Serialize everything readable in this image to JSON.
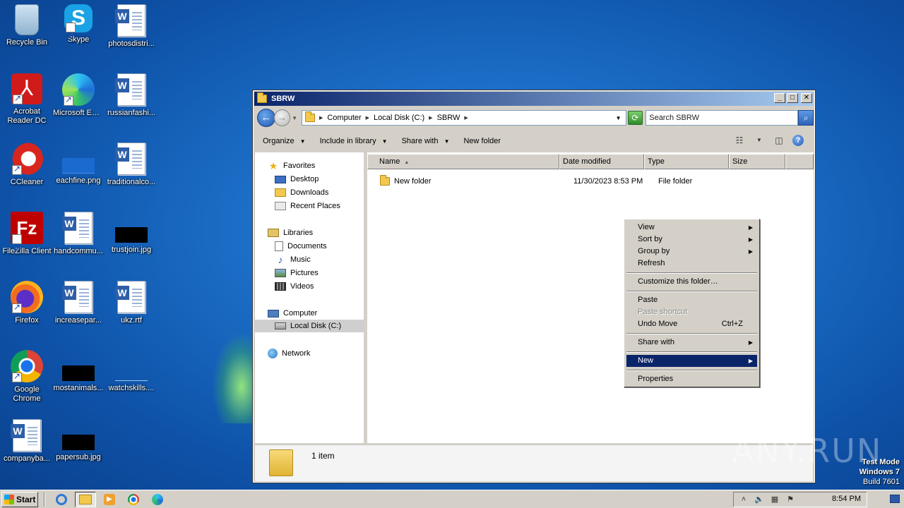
{
  "desktop": {
    "icons": [
      {
        "label": "Recycle Bin",
        "icon": "recycle-bin-icon"
      },
      {
        "label": "Skype",
        "icon": "skype-icon",
        "glyph": "S"
      },
      {
        "label": "photosdistri...",
        "icon": "word-document-icon"
      },
      {
        "label": "Acrobat Reader DC",
        "icon": "acrobat-icon"
      },
      {
        "label": "Microsoft Edge",
        "icon": "edge-icon"
      },
      {
        "label": "russianfashi...",
        "icon": "word-document-icon"
      },
      {
        "label": "CCleaner",
        "icon": "ccleaner-icon"
      },
      {
        "label": "eachfine.png",
        "icon": "image-file-icon"
      },
      {
        "label": "traditionalco...",
        "icon": "word-document-icon"
      },
      {
        "label": "FileZilla Client",
        "icon": "filezilla-icon",
        "glyph": "Fz"
      },
      {
        "label": "handcommu...",
        "icon": "word-document-icon"
      },
      {
        "label": "trustjoin.jpg",
        "icon": "image-file-icon"
      },
      {
        "label": "Firefox",
        "icon": "firefox-icon"
      },
      {
        "label": "increasepar...",
        "icon": "word-document-icon"
      },
      {
        "label": "ukz.rtf",
        "icon": "word-document-icon"
      },
      {
        "label": "Google Chrome",
        "icon": "chrome-icon"
      },
      {
        "label": "mostanimals...",
        "icon": "image-file-icon"
      },
      {
        "label": "watchskills....",
        "icon": "image-file-icon"
      },
      {
        "label": "companyba...",
        "icon": "word-document-icon"
      },
      {
        "label": "papersub.jpg",
        "icon": "image-file-icon"
      }
    ]
  },
  "window": {
    "title": "SBRW",
    "controls": {
      "minimize": "_",
      "maximize": "□",
      "close": "✕"
    },
    "address": {
      "crumbs": [
        "Computer",
        "Local Disk (C:)",
        "SBRW"
      ]
    },
    "search": {
      "placeholder": "Search SBRW"
    },
    "toolbar": {
      "organize": "Organize",
      "include_in_library": "Include in library",
      "share_with": "Share with",
      "new_folder": "New folder"
    },
    "nav_pane": {
      "favorites": "Favorites",
      "desktop": "Desktop",
      "downloads": "Downloads",
      "recent_places": "Recent Places",
      "libraries": "Libraries",
      "documents": "Documents",
      "music": "Music",
      "pictures": "Pictures",
      "videos": "Videos",
      "computer": "Computer",
      "local_disk": "Local Disk (C:)",
      "network": "Network"
    },
    "columns": {
      "name": "Name",
      "date_modified": "Date modified",
      "type": "Type",
      "size": "Size"
    },
    "files": [
      {
        "name": "New folder",
        "date_modified": "11/30/2023 8:53 PM",
        "type": "File folder",
        "size": ""
      }
    ],
    "status": "1 item"
  },
  "context_menu": {
    "view": "View",
    "sort_by": "Sort by",
    "group_by": "Group by",
    "refresh": "Refresh",
    "customize": "Customize this folder…",
    "paste": "Paste",
    "paste_shortcut": "Paste shortcut",
    "undo_move": "Undo Move",
    "undo_shortcut": "Ctrl+Z",
    "share_with": "Share with",
    "new": "New",
    "properties": "Properties"
  },
  "taskbar": {
    "start": "Start",
    "time": "8:54 PM"
  },
  "watermark": {
    "brand": "ANY.RUN",
    "test_mode": "Test Mode",
    "os": "Windows 7",
    "build": "Build 7601"
  },
  "colors": {
    "selection": "#0a246a",
    "titlebar_start": "#0a246a",
    "titlebar_end": "#a6caf0"
  }
}
